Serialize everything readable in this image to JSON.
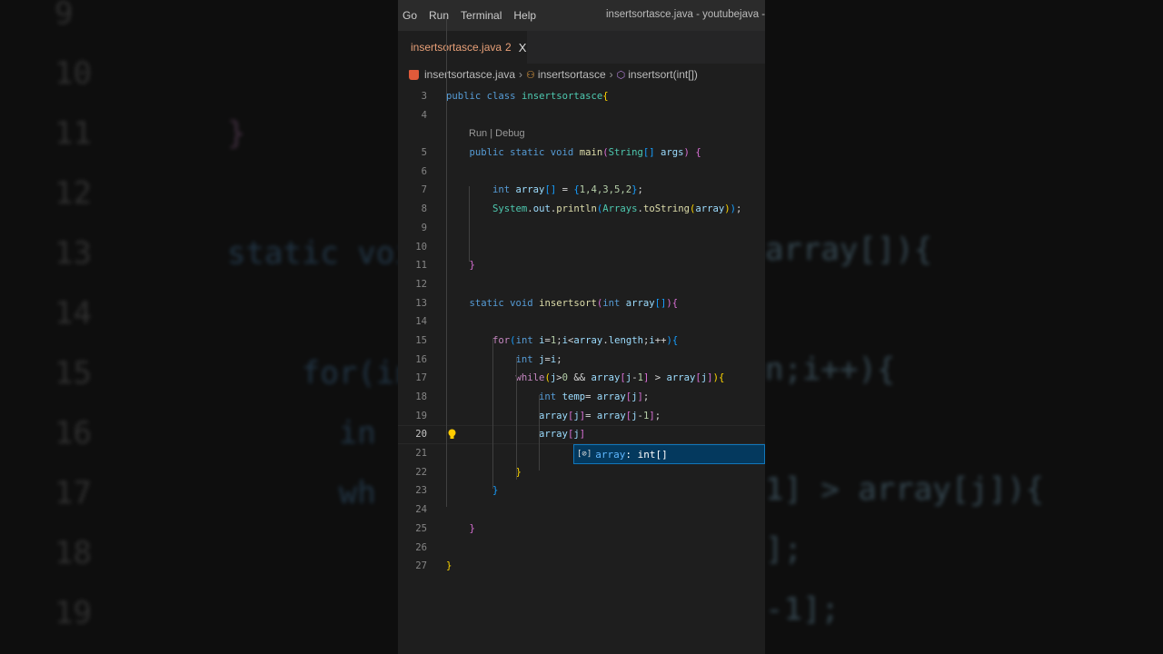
{
  "background": {
    "left_lines": [
      {
        "n": "9"
      },
      {
        "n": "10"
      },
      {
        "n": "11",
        "code": "}"
      },
      {
        "n": "12"
      },
      {
        "n": "13",
        "code": "static voi"
      },
      {
        "n": "14"
      },
      {
        "n": "15",
        "code": "    for(in"
      },
      {
        "n": "16",
        "code": "      in"
      },
      {
        "n": "17",
        "code": "      wh"
      },
      {
        "n": "18"
      },
      {
        "n": "19"
      }
    ],
    "right_lines": [
      "array[]){",
      "",
      "n;i++){",
      "",
      "1] > array[j]){",
      "];",
      "-1];"
    ]
  },
  "menu": {
    "items": [
      "Go",
      "Run",
      "Terminal",
      "Help"
    ],
    "title": "insertsortasce.java - youtubejava - Visua"
  },
  "tab": {
    "label": "insertsortasce.java",
    "problems": "2",
    "close": "X"
  },
  "breadcrumb": {
    "file": "insertsortasce.java",
    "class": "insertsortasce",
    "method": "insertsort(int[])"
  },
  "codelens": "Run | Debug",
  "lines": [
    {
      "n": "3",
      "t": [
        [
          "public ",
          "kw"
        ],
        [
          "class ",
          "kw"
        ],
        [
          "insertsortasce",
          "ty"
        ],
        [
          "{",
          "b1"
        ]
      ]
    },
    {
      "n": "4",
      "t": []
    },
    {
      "lens": true
    },
    {
      "n": "5",
      "t": [
        [
          "    public static void ",
          "kw"
        ],
        [
          "main",
          "fn"
        ],
        [
          "(",
          "b2"
        ],
        [
          "String",
          "ty"
        ],
        [
          "[]",
          "b3"
        ],
        [
          " args",
          "var"
        ],
        [
          ")",
          "b2"
        ],
        [
          " {",
          "b2"
        ]
      ]
    },
    {
      "n": "6",
      "t": []
    },
    {
      "n": "7",
      "t": [
        [
          "        int ",
          "kw"
        ],
        [
          "array",
          "var"
        ],
        [
          "[]",
          "b3"
        ],
        [
          " = ",
          "op"
        ],
        [
          "{",
          "b3"
        ],
        [
          "1,4,3,5,2",
          "num"
        ],
        [
          "}",
          "b3"
        ],
        [
          ";",
          "op"
        ]
      ]
    },
    {
      "n": "8",
      "t": [
        [
          "        System",
          "ty"
        ],
        [
          ".",
          "op"
        ],
        [
          "out",
          "var"
        ],
        [
          ".",
          "op"
        ],
        [
          "println",
          "fn"
        ],
        [
          "(",
          "b3"
        ],
        [
          "Arrays",
          "ty"
        ],
        [
          ".",
          "op"
        ],
        [
          "toString",
          "fn"
        ],
        [
          "(",
          "b1"
        ],
        [
          "array",
          "var"
        ],
        [
          ")",
          "b1"
        ],
        [
          ")",
          "b3"
        ],
        [
          ";",
          "op"
        ]
      ]
    },
    {
      "n": "9",
      "t": []
    },
    {
      "n": "10",
      "t": []
    },
    {
      "n": "11",
      "t": [
        [
          "    }",
          "b2"
        ]
      ]
    },
    {
      "n": "12",
      "t": []
    },
    {
      "n": "13",
      "t": [
        [
          "    static void ",
          "kw"
        ],
        [
          "insertsort",
          "fn"
        ],
        [
          "(",
          "b2"
        ],
        [
          "int ",
          "kw"
        ],
        [
          "array",
          "var"
        ],
        [
          "[]",
          "b3"
        ],
        [
          ")",
          "b2"
        ],
        [
          "{",
          "b2"
        ]
      ]
    },
    {
      "n": "14",
      "t": []
    },
    {
      "n": "15",
      "t": [
        [
          "        for",
          "ctl"
        ],
        [
          "(",
          "b3"
        ],
        [
          "int ",
          "kw"
        ],
        [
          "i",
          "var"
        ],
        [
          "=",
          "op"
        ],
        [
          "1",
          "num"
        ],
        [
          ";",
          "op"
        ],
        [
          "i",
          "var"
        ],
        [
          "<",
          "op"
        ],
        [
          "array",
          "var"
        ],
        [
          ".",
          "op"
        ],
        [
          "length",
          "var"
        ],
        [
          ";",
          "op"
        ],
        [
          "i",
          "var"
        ],
        [
          "++",
          "op"
        ],
        [
          ")",
          "b3"
        ],
        [
          "{",
          "b3"
        ]
      ]
    },
    {
      "n": "16",
      "t": [
        [
          "            int ",
          "kw"
        ],
        [
          "j",
          "var"
        ],
        [
          "=",
          "op"
        ],
        [
          "i",
          "var"
        ],
        [
          ";",
          "op"
        ]
      ]
    },
    {
      "n": "17",
      "t": [
        [
          "            while",
          "ctl"
        ],
        [
          "(",
          "b1"
        ],
        [
          "j",
          "var"
        ],
        [
          ">",
          "op"
        ],
        [
          "0",
          "num"
        ],
        [
          " && ",
          "op"
        ],
        [
          "array",
          "var"
        ],
        [
          "[",
          "b2"
        ],
        [
          "j",
          "var"
        ],
        [
          "-",
          "op"
        ],
        [
          "1",
          "num"
        ],
        [
          "]",
          "b2"
        ],
        [
          " > ",
          "op"
        ],
        [
          "array",
          "var"
        ],
        [
          "[",
          "b2"
        ],
        [
          "j",
          "var"
        ],
        [
          "]",
          "b2"
        ],
        [
          ")",
          "b1"
        ],
        [
          "{",
          "b1"
        ]
      ]
    },
    {
      "n": "18",
      "t": [
        [
          "                int ",
          "kw"
        ],
        [
          "temp",
          "var"
        ],
        [
          "= ",
          "op"
        ],
        [
          "array",
          "var"
        ],
        [
          "[",
          "b2"
        ],
        [
          "j",
          "var"
        ],
        [
          "]",
          "b2"
        ],
        [
          ";",
          "op"
        ]
      ]
    },
    {
      "n": "19",
      "t": [
        [
          "                array",
          "var"
        ],
        [
          "[",
          "b2"
        ],
        [
          "j",
          "var"
        ],
        [
          "]",
          "b2"
        ],
        [
          "= ",
          "op"
        ],
        [
          "array",
          "var"
        ],
        [
          "[",
          "b2"
        ],
        [
          "j",
          "var"
        ],
        [
          "-",
          "op"
        ],
        [
          "1",
          "num"
        ],
        [
          "]",
          "b2"
        ],
        [
          ";",
          "op"
        ]
      ]
    },
    {
      "n": "20",
      "cur": true,
      "t": [
        [
          "                array",
          "var"
        ],
        [
          "[",
          "b2"
        ],
        [
          "j",
          "var"
        ],
        [
          "]",
          "b2"
        ]
      ]
    },
    {
      "n": "21",
      "t": []
    },
    {
      "n": "22",
      "t": [
        [
          "            }",
          "b1"
        ]
      ]
    },
    {
      "n": "23",
      "t": [
        [
          "        }",
          "b3"
        ]
      ]
    },
    {
      "n": "24",
      "t": []
    },
    {
      "n": "25",
      "t": [
        [
          "    }",
          "b2"
        ]
      ]
    },
    {
      "n": "26",
      "t": []
    },
    {
      "n": "27",
      "t": [
        [
          "}",
          "b1"
        ]
      ]
    }
  ],
  "suggestion": {
    "icon": "[⊘]",
    "name": "array",
    "type": " : int[]"
  }
}
